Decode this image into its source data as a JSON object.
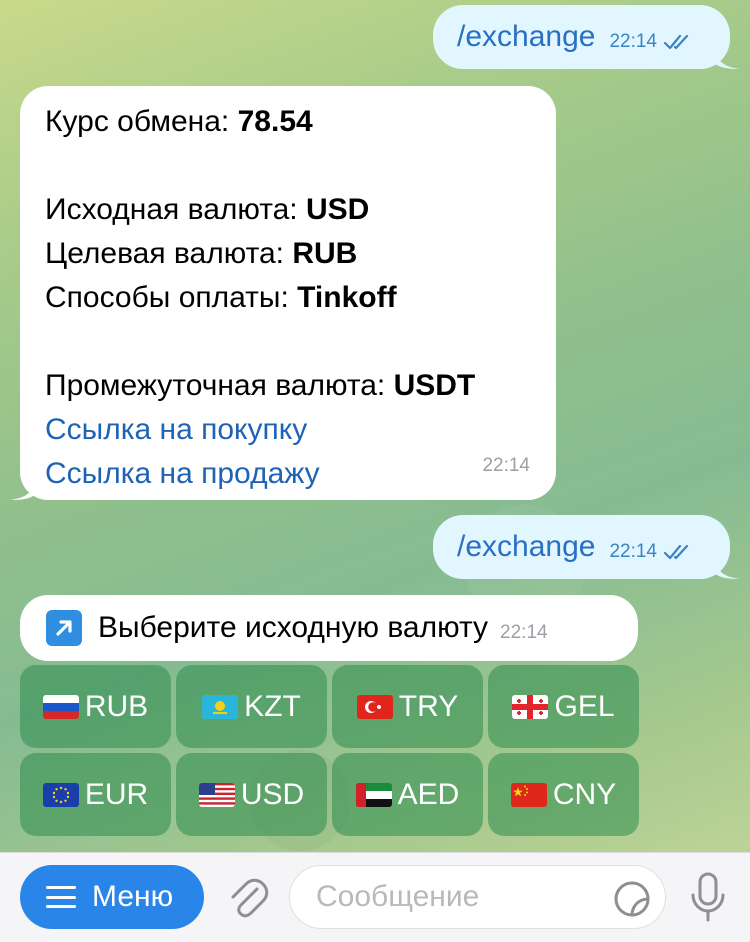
{
  "chat": {
    "out_message_1": {
      "text": "/exchange",
      "time": "22:14"
    },
    "result_message": {
      "rate_label": "Курс обмена: ",
      "rate_value": "78.54",
      "source_label": "Исходная валюта: ",
      "source_value": "USD",
      "target_label": "Целевая валюта: ",
      "target_value": "RUB",
      "payment_label": "Способы оплаты: ",
      "payment_value": "Tinkoff",
      "intermediate_label": "Промежуточная валюта: ",
      "intermediate_value": "USDT",
      "buy_link": "Ссылка на покупку",
      "sell_link": "Ссылка на продажу",
      "time": "22:14"
    },
    "out_message_2": {
      "text": "/exchange",
      "time": "22:14"
    },
    "choose_message": {
      "text": "Выберите исходную валюту",
      "time": "22:14"
    }
  },
  "keyboard": {
    "buttons": [
      {
        "label": "RUB",
        "flag": "russia-flag"
      },
      {
        "label": "KZT",
        "flag": "kazakhstan-flag"
      },
      {
        "label": "TRY",
        "flag": "turkey-flag"
      },
      {
        "label": "GEL",
        "flag": "georgia-flag"
      },
      {
        "label": "EUR",
        "flag": "eu-flag"
      },
      {
        "label": "USD",
        "flag": "usa-flag"
      },
      {
        "label": "AED",
        "flag": "uae-flag"
      },
      {
        "label": "CNY",
        "flag": "china-flag"
      }
    ]
  },
  "composer": {
    "menu_label": "Меню",
    "placeholder": "Сообщение"
  },
  "colors": {
    "outgoing_bubble": "#e1f6fe",
    "link": "#1f63b5",
    "menu_button": "#2a85e8",
    "keyboard_button": "#2e8c4e"
  }
}
